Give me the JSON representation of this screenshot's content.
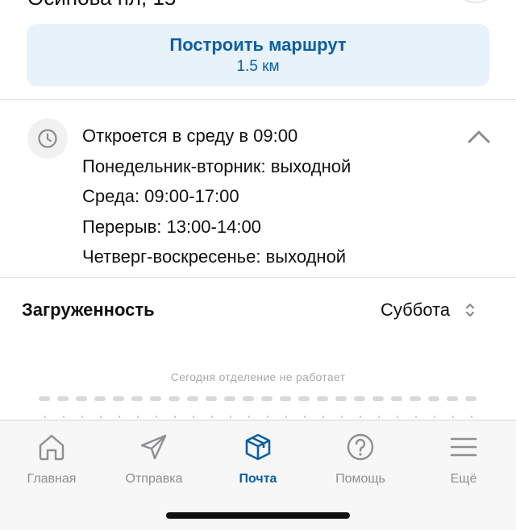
{
  "header": {
    "address_partial": "Осинова пл, 15"
  },
  "route": {
    "title": "Построить маршрут",
    "distance": "1.5 км"
  },
  "hours": {
    "lines": [
      "Откроется в среду в 09:00",
      "Понедельник-вторник: выходной",
      "Среда: 09:00-17:00",
      "Перерыв: 13:00-14:00",
      "Четверг-воскресенье: выходной"
    ],
    "icon": "clock-icon",
    "toggle_icon": "chevron-up-icon"
  },
  "load": {
    "label": "Загруженность",
    "day": "Суббота",
    "note": "Сегодня отделение не работает"
  },
  "tabbar": {
    "tabs": [
      {
        "label": "Главная",
        "icon": "home-icon"
      },
      {
        "label": "Отправка",
        "icon": "paper-plane-icon"
      },
      {
        "label": "Почта",
        "icon": "package-icon"
      },
      {
        "label": "Помощь",
        "icon": "help-icon"
      },
      {
        "label": "Ещё",
        "icon": "menu-icon"
      }
    ],
    "active": "Почта"
  },
  "colors": {
    "accent": "#0b5fa3",
    "route_bg": "#e8f2fb",
    "inactive": "#8e8e93"
  }
}
